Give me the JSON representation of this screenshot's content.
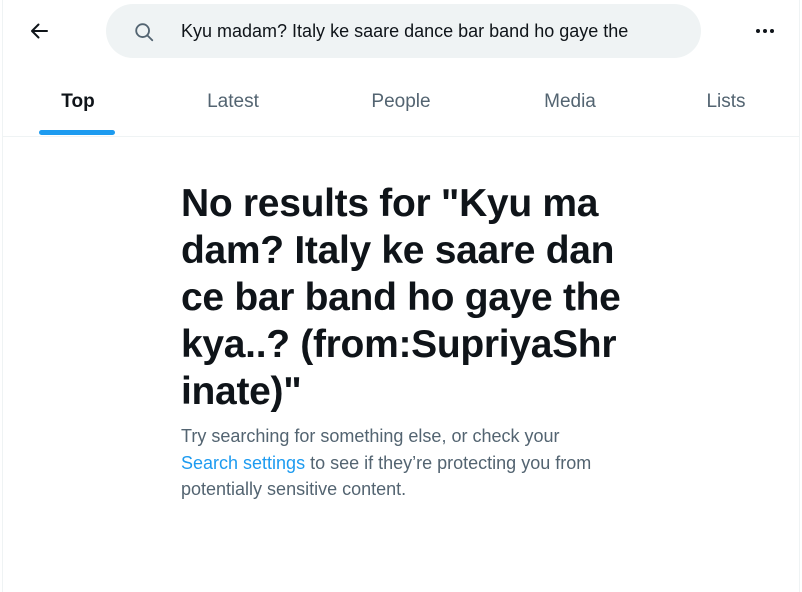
{
  "search": {
    "query": "Kyu madam? Italy ke saare dance bar band ho gaye the"
  },
  "tabs": [
    {
      "label": "Top",
      "active": true
    },
    {
      "label": "Latest",
      "active": false
    },
    {
      "label": "People",
      "active": false
    },
    {
      "label": "Media",
      "active": false
    },
    {
      "label": "Lists",
      "active": false
    }
  ],
  "empty_state": {
    "title": "No results for \"Kyu madam? Italy ke saare dance bar band ho gaye the kya..? (from:SupriyaShrinate)\"",
    "desc_before": "Try searching for something else, or check your ",
    "link": "Search settings",
    "desc_after": " to see if they’re protecting you from potentially sensitive content."
  },
  "icons": {
    "back": "arrow-left-icon",
    "search": "search-icon",
    "more": "more-horizontal-icon"
  },
  "colors": {
    "accent": "#1d9bf0",
    "text_primary": "#0f1419",
    "text_secondary": "#536471",
    "search_bg": "#eff3f4"
  }
}
